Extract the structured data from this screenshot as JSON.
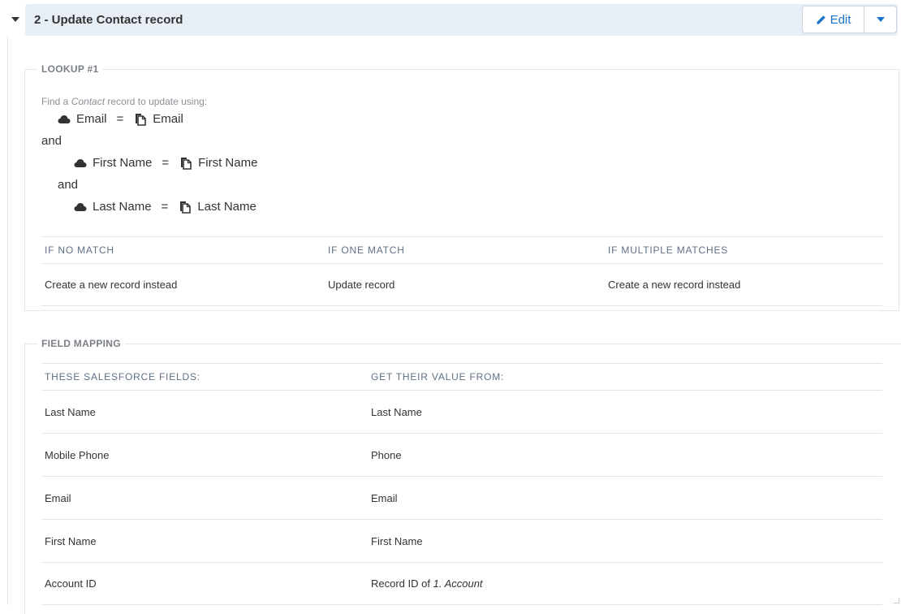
{
  "step": {
    "title": "2 - Update Contact record",
    "edit_label": "Edit",
    "accent_color": "#1a73c9",
    "header_bg": "#e8eef6"
  },
  "lookup": {
    "legend": "LOOKUP #1",
    "find_prefix": "Find a ",
    "find_object": "Contact",
    "find_suffix": " record to update using:",
    "conditions": [
      {
        "left": "Email",
        "op": "=",
        "right": "Email",
        "left_icon": "cloud-icon",
        "right_icon": "copy-icon"
      },
      {
        "left": "First Name",
        "op": "=",
        "right": "First Name",
        "left_icon": "cloud-icon",
        "right_icon": "copy-icon"
      },
      {
        "left": "Last Name",
        "op": "=",
        "right": "Last Name",
        "left_icon": "cloud-icon",
        "right_icon": "copy-icon"
      }
    ],
    "joiners": [
      "and",
      "and"
    ],
    "headers": [
      "IF NO MATCH",
      "IF ONE MATCH",
      "IF MULTIPLE MATCHES"
    ],
    "actions": [
      "Create a new record instead",
      "Update record",
      "Create a new record instead"
    ]
  },
  "mapping": {
    "legend": "FIELD MAPPING",
    "headers": [
      "THESE SALESFORCE FIELDS:",
      "GET THEIR VALUE FROM:"
    ],
    "rows": [
      {
        "field": "Last Name",
        "source": "Last Name"
      },
      {
        "field": "Mobile Phone",
        "source": "Phone"
      },
      {
        "field": "Email",
        "source": "Email"
      },
      {
        "field": "First Name",
        "source": "First Name"
      },
      {
        "field": "Account ID",
        "source_prefix": "Record ID of ",
        "source_italic": "1. Account"
      }
    ]
  }
}
